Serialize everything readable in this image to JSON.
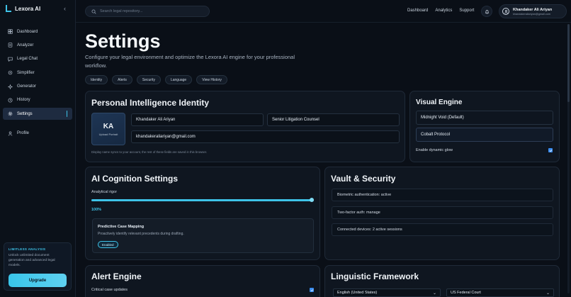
{
  "app": {
    "brand": "Lexora AI"
  },
  "sidebar": {
    "items": [
      {
        "label": "Dashboard",
        "icon": "dashboard-icon"
      },
      {
        "label": "Analyzer",
        "icon": "analyzer-icon"
      },
      {
        "label": "Legal Chat",
        "icon": "chat-icon"
      },
      {
        "label": "Simplifier",
        "icon": "simplifier-icon"
      },
      {
        "label": "Generator",
        "icon": "generator-icon"
      },
      {
        "label": "History",
        "icon": "history-icon"
      },
      {
        "label": "Settings",
        "icon": "gear-icon",
        "active": true
      }
    ],
    "profile": {
      "label": "Profile",
      "icon": "user-icon"
    },
    "promo": {
      "title": "LIMITLESS ANALYSIS",
      "text": "Unlock unlimited document generation and advanced legal models.",
      "button": "Upgrade"
    }
  },
  "topbar": {
    "search_placeholder": "Search legal repository...",
    "links": [
      "Dashboard",
      "Analytics",
      "Support"
    ],
    "user": {
      "name": "Khandaker Ali Ariyan",
      "email": "khandakeraliariyan@gmail.com"
    }
  },
  "main": {
    "title": "Settings",
    "subtitle": "Configure your legal environment and optimize the Lexora AI engine for your professional workflow.",
    "chips": [
      "Identity",
      "Alerts",
      "Security",
      "Language",
      "View History"
    ]
  },
  "identity": {
    "title": "Personal Intelligence Identity",
    "avatar_initials": "KA",
    "avatar_caption": "Upload Portrait",
    "name": "Khandaker Ali Ariyan",
    "role": "Senior Litigation Counsel",
    "email": "khandakeraliariyan@gmail.com",
    "note": "Display name syncs to your account, the rest of these fields are saved in this browser."
  },
  "visual": {
    "title": "Visual Engine",
    "options": [
      "Midnight Void (Default)",
      "Cobalt Protocol"
    ],
    "glow_label": "Enable dynamic glow",
    "glow_checked": true
  },
  "cognition": {
    "title": "AI Cognition Settings",
    "slider_label": "Analytical rigor",
    "slider_value": "100%",
    "slider_fraction": 1.0,
    "feature_title": "Predictive Case Mapping",
    "feature_desc": "Proactively identify relevant precedents during drafting.",
    "feature_status": "Enabled"
  },
  "vault": {
    "title": "Vault & Security",
    "rows": [
      "Biometric authentication: active",
      "Two-factor auth: manage",
      "Connected devices: 2 active sessions"
    ]
  },
  "alerts": {
    "title": "Alert Engine",
    "item": "Critical case updates",
    "checked": true
  },
  "linguistic": {
    "title": "Linguistic Framework",
    "language": "English (United States)",
    "jurisdiction": "US Federal Court"
  },
  "colors": {
    "accent": "#3ec3e8",
    "checkbox": "#3b8df0",
    "background": "#0a0f17"
  }
}
